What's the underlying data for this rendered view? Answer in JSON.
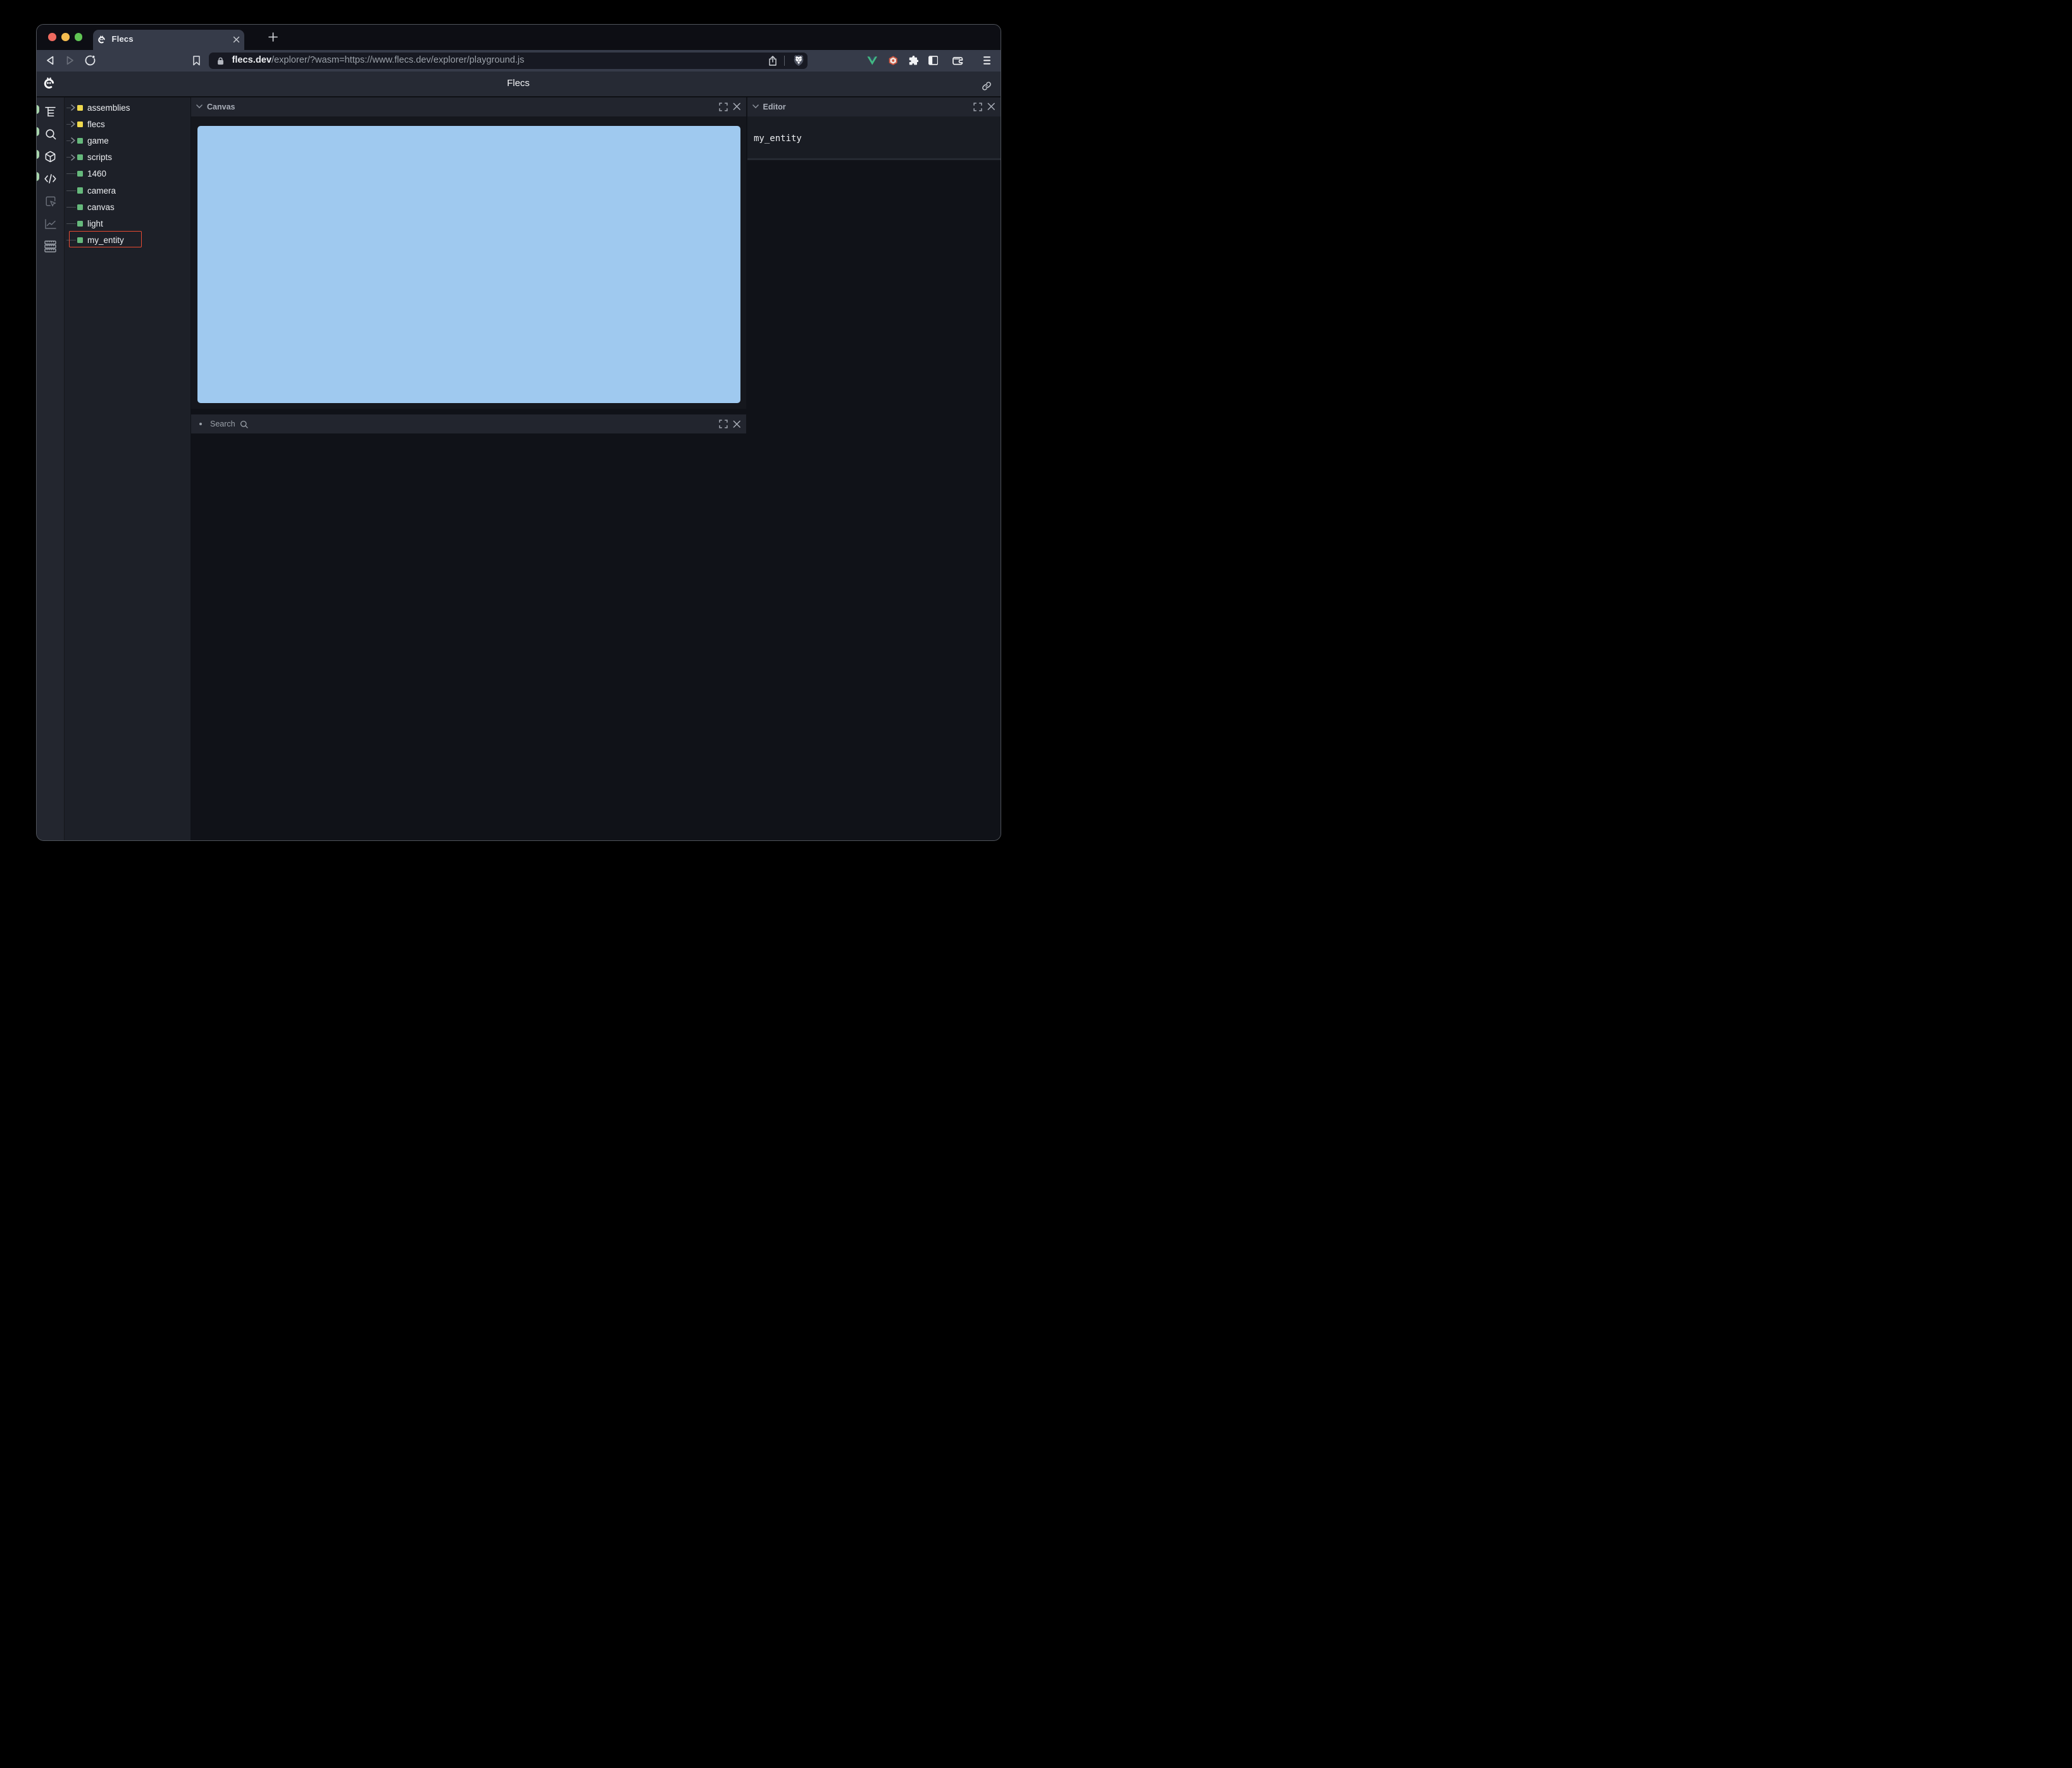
{
  "browser": {
    "tab_title": "Flecs",
    "url_host": "flecs.dev",
    "url_path": "/explorer/?wasm=https://www.flecs.dev/explorer/playground.js",
    "traffic_lights": {
      "close": "#ee6a5f",
      "minimize": "#f5bd4f",
      "zoom": "#61c554"
    }
  },
  "header": {
    "title": "Flecs"
  },
  "sidebar": {
    "items": [
      {
        "icon": "tree",
        "active": true
      },
      {
        "icon": "search",
        "active": true
      },
      {
        "icon": "box",
        "active": true
      },
      {
        "icon": "code",
        "active": true
      },
      {
        "icon": "inspect",
        "active": false
      },
      {
        "icon": "chart",
        "active": false
      },
      {
        "icon": "rows",
        "active": false
      }
    ]
  },
  "tree": {
    "items": [
      {
        "label": "assemblies",
        "color": "#efd94e",
        "expandable": true,
        "selected": false
      },
      {
        "label": "flecs",
        "color": "#efd94e",
        "expandable": true,
        "selected": false
      },
      {
        "label": "game",
        "color": "#66b97c",
        "expandable": true,
        "selected": false
      },
      {
        "label": "scripts",
        "color": "#66b97c",
        "expandable": true,
        "selected": false
      },
      {
        "label": "1460",
        "color": "#66b97c",
        "expandable": false,
        "selected": false
      },
      {
        "label": "camera",
        "color": "#66b97c",
        "expandable": false,
        "selected": false
      },
      {
        "label": "canvas",
        "color": "#66b97c",
        "expandable": false,
        "selected": false
      },
      {
        "label": "light",
        "color": "#66b97c",
        "expandable": false,
        "selected": false
      },
      {
        "label": "my_entity",
        "color": "#66b97c",
        "expandable": false,
        "selected": true
      }
    ],
    "selection_color": "#e84a31"
  },
  "panels": {
    "canvas": {
      "title": "Canvas",
      "color": "#9fc9ef"
    },
    "search": {
      "title": "Search"
    },
    "editor": {
      "title": "Editor",
      "content": "my_entity"
    }
  }
}
